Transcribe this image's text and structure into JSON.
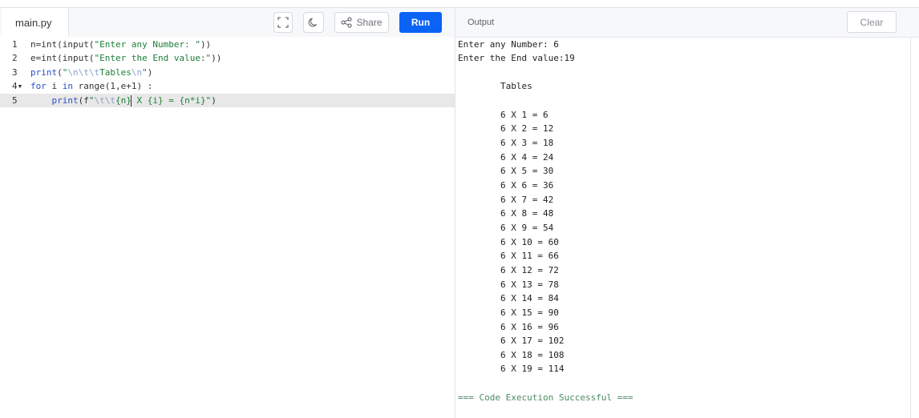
{
  "editor": {
    "filename": "main.py",
    "run_label": "Run",
    "share_label": "Share",
    "lines": [
      {
        "num": "1",
        "parts": [
          [
            "plain",
            "n=int(input("
          ],
          [
            "str",
            "\"Enter any Number: \""
          ],
          [
            "plain",
            "))"
          ]
        ]
      },
      {
        "num": "2",
        "parts": [
          [
            "plain",
            "e=int(input("
          ],
          [
            "str",
            "\"Enter the End value:\""
          ],
          [
            "plain",
            "))"
          ]
        ]
      },
      {
        "num": "3",
        "parts": [
          [
            "fn",
            "print"
          ],
          [
            "plain",
            "("
          ],
          [
            "str",
            "\""
          ],
          [
            "esc",
            "\\n\\t\\t"
          ],
          [
            "str",
            "Tables"
          ],
          [
            "esc",
            "\\n"
          ],
          [
            "str",
            "\""
          ],
          [
            "plain",
            ")"
          ]
        ]
      },
      {
        "num": "4",
        "fold": "▾",
        "parts": [
          [
            "kw",
            "for"
          ],
          [
            "plain",
            " i "
          ],
          [
            "kw",
            "in"
          ],
          [
            "plain",
            " range(1,e+1) :"
          ]
        ]
      },
      {
        "num": "5",
        "parts": [
          [
            "plain",
            "    "
          ],
          [
            "fn",
            "print"
          ],
          [
            "plain",
            "(f"
          ],
          [
            "str",
            "\""
          ],
          [
            "esc",
            "\\t\\t"
          ],
          [
            "str",
            "{n}"
          ],
          [
            "cursor",
            ""
          ],
          [
            "str",
            " X {i} = {n*i}\""
          ],
          [
            "plain",
            ")"
          ]
        ]
      }
    ]
  },
  "output": {
    "title": "Output",
    "clear_label": "Clear",
    "lines": [
      "Enter any Number: 6",
      "Enter the End value:19",
      "",
      "        Tables",
      "",
      "        6 X 1 = 6",
      "        6 X 2 = 12",
      "        6 X 3 = 18",
      "        6 X 4 = 24",
      "        6 X 5 = 30",
      "        6 X 6 = 36",
      "        6 X 7 = 42",
      "        6 X 8 = 48",
      "        6 X 9 = 54",
      "        6 X 10 = 60",
      "        6 X 11 = 66",
      "        6 X 12 = 72",
      "        6 X 13 = 78",
      "        6 X 14 = 84",
      "        6 X 15 = 90",
      "        6 X 16 = 96",
      "        6 X 17 = 102",
      "        6 X 18 = 108",
      "        6 X 19 = 114",
      "",
      "=== Code Execution Successful ==="
    ]
  },
  "icons": {
    "fullscreen": "fullscreen-icon",
    "theme": "moon-icon",
    "share": "share-icon"
  },
  "colors": {
    "run_button": "#0b63f6",
    "active_line": "#e8e8e8",
    "keyword": "#2c4fc9",
    "string": "#1a7f37",
    "success": "#4b8a63"
  }
}
